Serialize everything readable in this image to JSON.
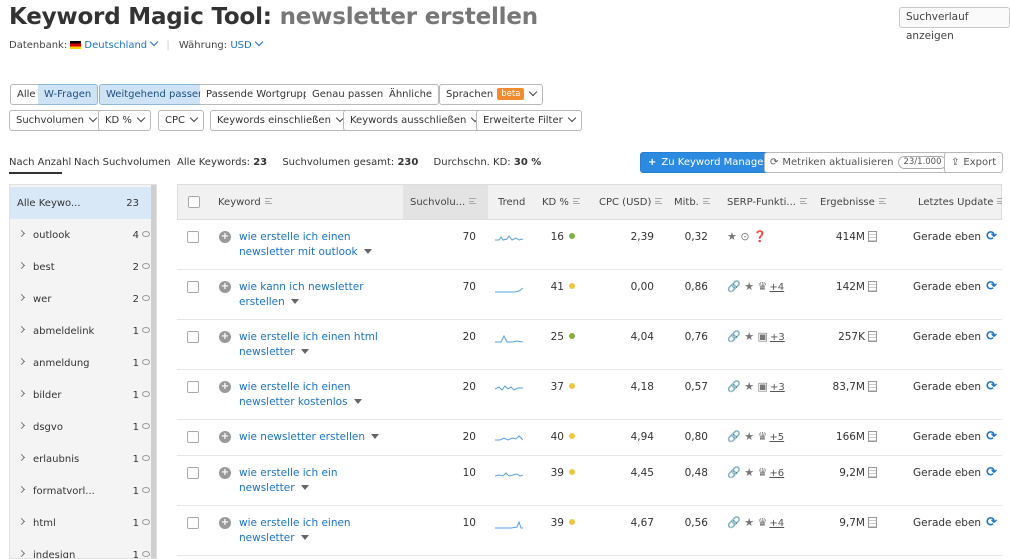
{
  "header": {
    "title_main": "Keyword Magic Tool:",
    "title_query": "newsletter erstellen",
    "history_button": "Suchverlauf anzeigen",
    "database_label": "Datenbank:",
    "database_value": "Deutschland",
    "currency_label": "Währung:",
    "currency_value": "USD"
  },
  "filters": {
    "group1": [
      "Alle",
      "W-Fragen"
    ],
    "group1_active": "W-Fragen",
    "group2": [
      "Weitgehend passend",
      "Passende Wortgruppe",
      "Genau passend",
      "Ähnliche"
    ],
    "group2_active": "Weitgehend passend",
    "languages": "Sprachen",
    "beta": "beta",
    "row2": [
      "Suchvolumen",
      "KD %",
      "CPC",
      "Keywords einschließen",
      "Keywords ausschließen",
      "Erweiterte Filter"
    ]
  },
  "tabs": [
    "Nach Anzahl",
    "Nach Suchvolumen"
  ],
  "summary": {
    "all_label": "Alle Keywords:",
    "all_value": "23",
    "vol_label": "Suchvolumen gesamt:",
    "vol_value": "230",
    "kd_label": "Durchschn. KD:",
    "kd_value": "30 %"
  },
  "actions": {
    "keyword_manager": "Zu Keyword Manager",
    "update_metrics": "Metriken aktualisieren",
    "update_count": "23/1.000",
    "export": "Export"
  },
  "sidebar": [
    {
      "label": "Alle Keywo...",
      "count": "23"
    },
    {
      "label": "outlook",
      "count": "4"
    },
    {
      "label": "best",
      "count": "2"
    },
    {
      "label": "wer",
      "count": "2"
    },
    {
      "label": "abmeldelink",
      "count": "1"
    },
    {
      "label": "anmeldung",
      "count": "1"
    },
    {
      "label": "bilder",
      "count": "1"
    },
    {
      "label": "dsgvo",
      "count": "1"
    },
    {
      "label": "erlaubnis",
      "count": "1"
    },
    {
      "label": "formatvorl...",
      "count": "1"
    },
    {
      "label": "html",
      "count": "1"
    },
    {
      "label": "indesign",
      "count": "1"
    }
  ],
  "columns": [
    "Keyword",
    "Suchvolu...",
    "Trend",
    "KD %",
    "CPC (USD)",
    "Mitb.",
    "SERP-Funkti...",
    "Ergebnisse",
    "Letztes Update"
  ],
  "rows": [
    {
      "line1": "wie erstelle ich einen",
      "line2": "newsletter mit outlook",
      "volume": "70",
      "kd": "16",
      "kd_color": "#7cb342",
      "cpc": "2,39",
      "comp": "0,32",
      "serp_icons": "★ ⊙ ❓",
      "serp_more": "",
      "results": "414M",
      "updated": "Gerade eben"
    },
    {
      "line1": "wie kann ich newsletter",
      "line2": "erstellen",
      "volume": "70",
      "kd": "41",
      "kd_color": "#f5c542",
      "cpc": "0,00",
      "comp": "0,86",
      "serp_icons": "🔗 ★ ♛",
      "serp_more": "+4",
      "results": "142M",
      "updated": "Gerade eben"
    },
    {
      "line1": "wie erstelle ich einen html",
      "line2": "newsletter",
      "volume": "20",
      "kd": "25",
      "kd_color": "#7cb342",
      "cpc": "4,04",
      "comp": "0,76",
      "serp_icons": "🔗 ★ ▣",
      "serp_more": "+3",
      "results": "257K",
      "updated": "Gerade eben"
    },
    {
      "line1": "wie erstelle ich einen",
      "line2": "newsletter kostenlos",
      "volume": "20",
      "kd": "37",
      "kd_color": "#f5c542",
      "cpc": "4,18",
      "comp": "0,57",
      "serp_icons": "🔗 ★ ▣",
      "serp_more": "+3",
      "results": "83,7M",
      "updated": "Gerade eben"
    },
    {
      "line1": "wie newsletter erstellen",
      "line2": "",
      "volume": "20",
      "kd": "40",
      "kd_color": "#f5c542",
      "cpc": "4,94",
      "comp": "0,80",
      "serp_icons": "🔗 ★ ♛",
      "serp_more": "+5",
      "results": "166M",
      "updated": "Gerade eben"
    },
    {
      "line1": "wie erstelle ich ein",
      "line2": "newsletter",
      "volume": "10",
      "kd": "39",
      "kd_color": "#f5c542",
      "cpc": "4,45",
      "comp": "0,48",
      "serp_icons": "🔗 ★ ♛",
      "serp_more": "+6",
      "results": "9,2M",
      "updated": "Gerade eben"
    },
    {
      "line1": "wie erstelle ich einen",
      "line2": "newsletter",
      "volume": "10",
      "kd": "39",
      "kd_color": "#f5c542",
      "cpc": "4,67",
      "comp": "0,56",
      "serp_icons": "🔗 ★ ♛",
      "serp_more": "+4",
      "results": "9,7M",
      "updated": "Gerade eben"
    }
  ]
}
